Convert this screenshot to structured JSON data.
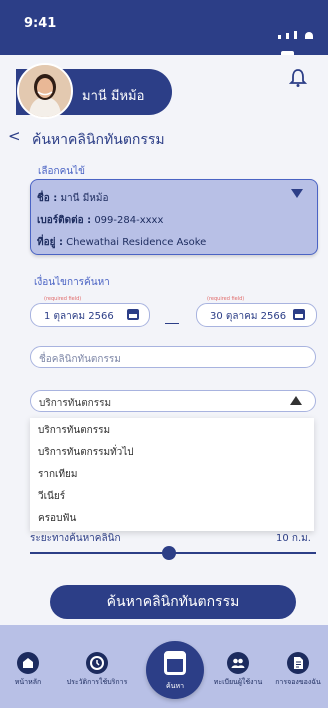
{
  "status_bar": {
    "time": "9:41"
  },
  "profile": {
    "name": "มานี มีหม้อ"
  },
  "header": {
    "back_symbol": "<",
    "title": "ค้นหาคลินิกทันตกรรม"
  },
  "patient_section": {
    "label": "เลือกคนไข้",
    "name_label": "ชื่อ :",
    "name_value": "มานี มีหม้อ",
    "phone_label": "เบอร์ติดต่อ :",
    "phone_value": "099-284-xxxx",
    "address_label": "ที่อยู่ :",
    "address_value": "Chewathai Residence Asoke"
  },
  "search_conditions": {
    "label": "เงื่อนไขการค้นหา",
    "required_note": "(required field)",
    "start_date": "1 ตุลาคม 2566",
    "end_date": "30 ตุลาคม 2566",
    "clinic_name_placeholder": "ชื่อคลินิกทันตกรรม",
    "service_selected": "บริการทันตกรรม",
    "service_options": [
      "บริการทันตกรรม",
      "บริการทันตกรรมทั่วไป",
      "รากเทียม",
      "วีเนียร์",
      "ครอบฟัน"
    ],
    "distance_label": "ระยะทางค้นหาคลินิก",
    "distance_value": "10 ก.ม.",
    "distance_level_fraction": 0.5
  },
  "search_button_label": "ค้นหาคลินิกทันตกรรม",
  "bottom_nav": {
    "home": "หน้าหลัก",
    "history": "ประวัติการใช้บริการ",
    "search": "ค้นหา",
    "register": "ทะเบียนผู้ใช้งาน",
    "booking": "การจองของฉัน"
  },
  "colors": {
    "primary": "#2c3e87",
    "card": "#b8c0e6",
    "accent": "#4a63c4"
  }
}
